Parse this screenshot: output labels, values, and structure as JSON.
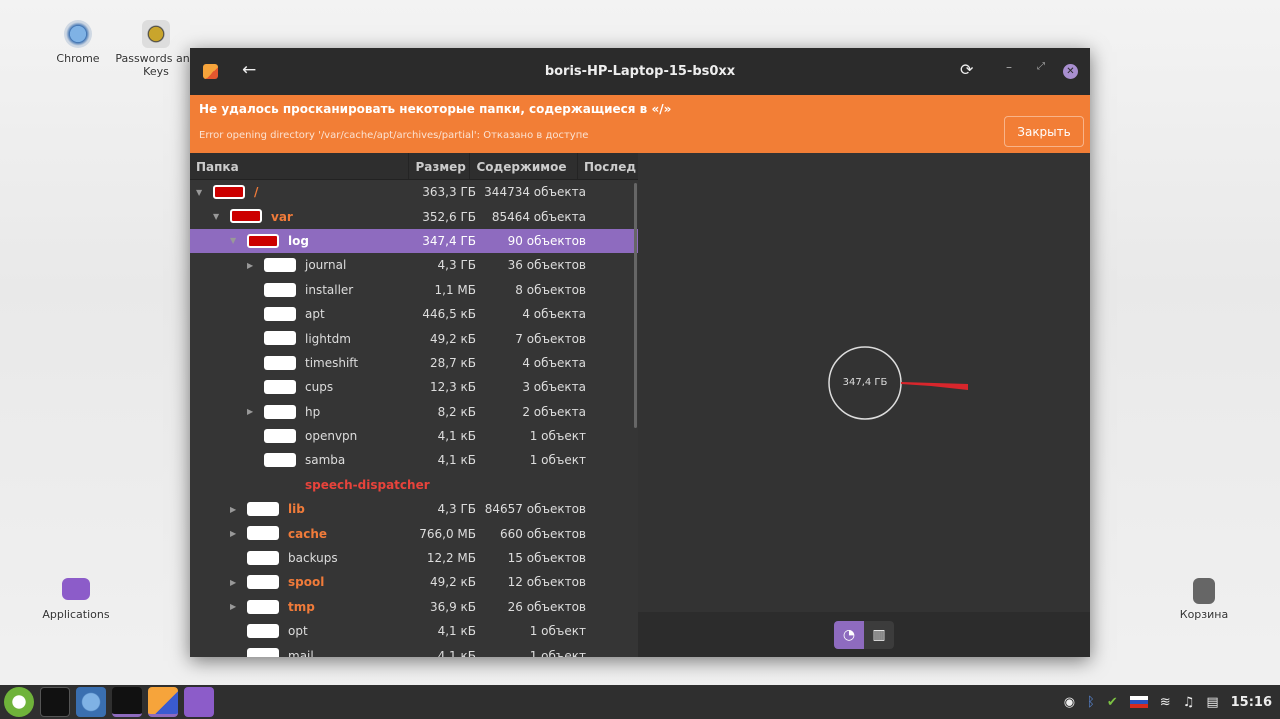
{
  "desktop": {
    "icons": [
      {
        "label": "Chrome"
      },
      {
        "label": "Passwords and Keys"
      },
      {
        "label": "Applications"
      },
      {
        "label": "Корзина"
      }
    ]
  },
  "window": {
    "title": "boris-HP-Laptop-15-bs0xx"
  },
  "banner": {
    "heading": "Не удалось просканировать некоторые папки, содержащиеся в «/»",
    "detail": "Error opening directory '/var/cache/apt/archives/partial': Отказано в доступе",
    "close_label": "Закрыть"
  },
  "columns": [
    "Папка",
    "Размер",
    "Содержимое",
    "Послед"
  ],
  "rows": [
    {
      "name": "/",
      "level": 0,
      "exp": "open",
      "icon": "red",
      "style": "or",
      "size": "363,3 ГБ",
      "contents": "344734 объекта"
    },
    {
      "name": "var",
      "level": 1,
      "exp": "open",
      "icon": "red",
      "style": "or",
      "size": "352,6 ГБ",
      "contents": "85464 объекта"
    },
    {
      "name": "log",
      "level": 2,
      "exp": "open",
      "icon": "red",
      "style": "sel",
      "size": "347,4 ГБ",
      "contents": "90 объектов"
    },
    {
      "name": "journal",
      "level": 3,
      "exp": "closed",
      "icon": "white",
      "style": "",
      "size": "4,3 ГБ",
      "contents": "36 объектов"
    },
    {
      "name": "installer",
      "level": 3,
      "exp": "",
      "icon": "white",
      "style": "",
      "size": "1,1 МБ",
      "contents": "8 объектов"
    },
    {
      "name": "apt",
      "level": 3,
      "exp": "",
      "icon": "white",
      "style": "",
      "size": "446,5 кБ",
      "contents": "4 объекта"
    },
    {
      "name": "lightdm",
      "level": 3,
      "exp": "",
      "icon": "white",
      "style": "",
      "size": "49,2 кБ",
      "contents": "7 объектов"
    },
    {
      "name": "timeshift",
      "level": 3,
      "exp": "",
      "icon": "white",
      "style": "",
      "size": "28,7 кБ",
      "contents": "4 объекта"
    },
    {
      "name": "cups",
      "level": 3,
      "exp": "",
      "icon": "white",
      "style": "",
      "size": "12,3 кБ",
      "contents": "3 объекта"
    },
    {
      "name": "hp",
      "level": 3,
      "exp": "closed",
      "icon": "white",
      "style": "",
      "size": "8,2 кБ",
      "contents": "2 объекта"
    },
    {
      "name": "openvpn",
      "level": 3,
      "exp": "",
      "icon": "white",
      "style": "",
      "size": "4,1 кБ",
      "contents": "1 объект"
    },
    {
      "name": "samba",
      "level": 3,
      "exp": "",
      "icon": "white",
      "style": "",
      "size": "4,1 кБ",
      "contents": "1 объект"
    },
    {
      "name": "speech-dispatcher",
      "level": 3,
      "exp": "",
      "icon": "",
      "style": "rd",
      "size": "",
      "contents": ""
    },
    {
      "name": "lib",
      "level": 2,
      "exp": "closed",
      "icon": "white",
      "style": "or",
      "size": "4,3 ГБ",
      "contents": "84657 объектов"
    },
    {
      "name": "cache",
      "level": 2,
      "exp": "closed",
      "icon": "white",
      "style": "or",
      "size": "766,0 МБ",
      "contents": "660 объектов"
    },
    {
      "name": "backups",
      "level": 2,
      "exp": "",
      "icon": "white",
      "style": "",
      "size": "12,2 МБ",
      "contents": "15 объектов"
    },
    {
      "name": "spool",
      "level": 2,
      "exp": "closed",
      "icon": "white",
      "style": "or",
      "size": "49,2 кБ",
      "contents": "12 объектов"
    },
    {
      "name": "tmp",
      "level": 2,
      "exp": "closed",
      "icon": "white",
      "style": "or",
      "size": "36,9 кБ",
      "contents": "26 объектов"
    },
    {
      "name": "opt",
      "level": 2,
      "exp": "",
      "icon": "white",
      "style": "",
      "size": "4,1 кБ",
      "contents": "1 объект"
    },
    {
      "name": "mail",
      "level": 2,
      "exp": "",
      "icon": "white",
      "style": "",
      "size": "4,1 кБ",
      "contents": "1 объект"
    }
  ],
  "chart": {
    "center_label": "347,4 ГБ"
  },
  "taskbar": {
    "clock": "15:16"
  },
  "colors": {
    "accent": "#f27e36",
    "selection": "#8e6bbf"
  }
}
